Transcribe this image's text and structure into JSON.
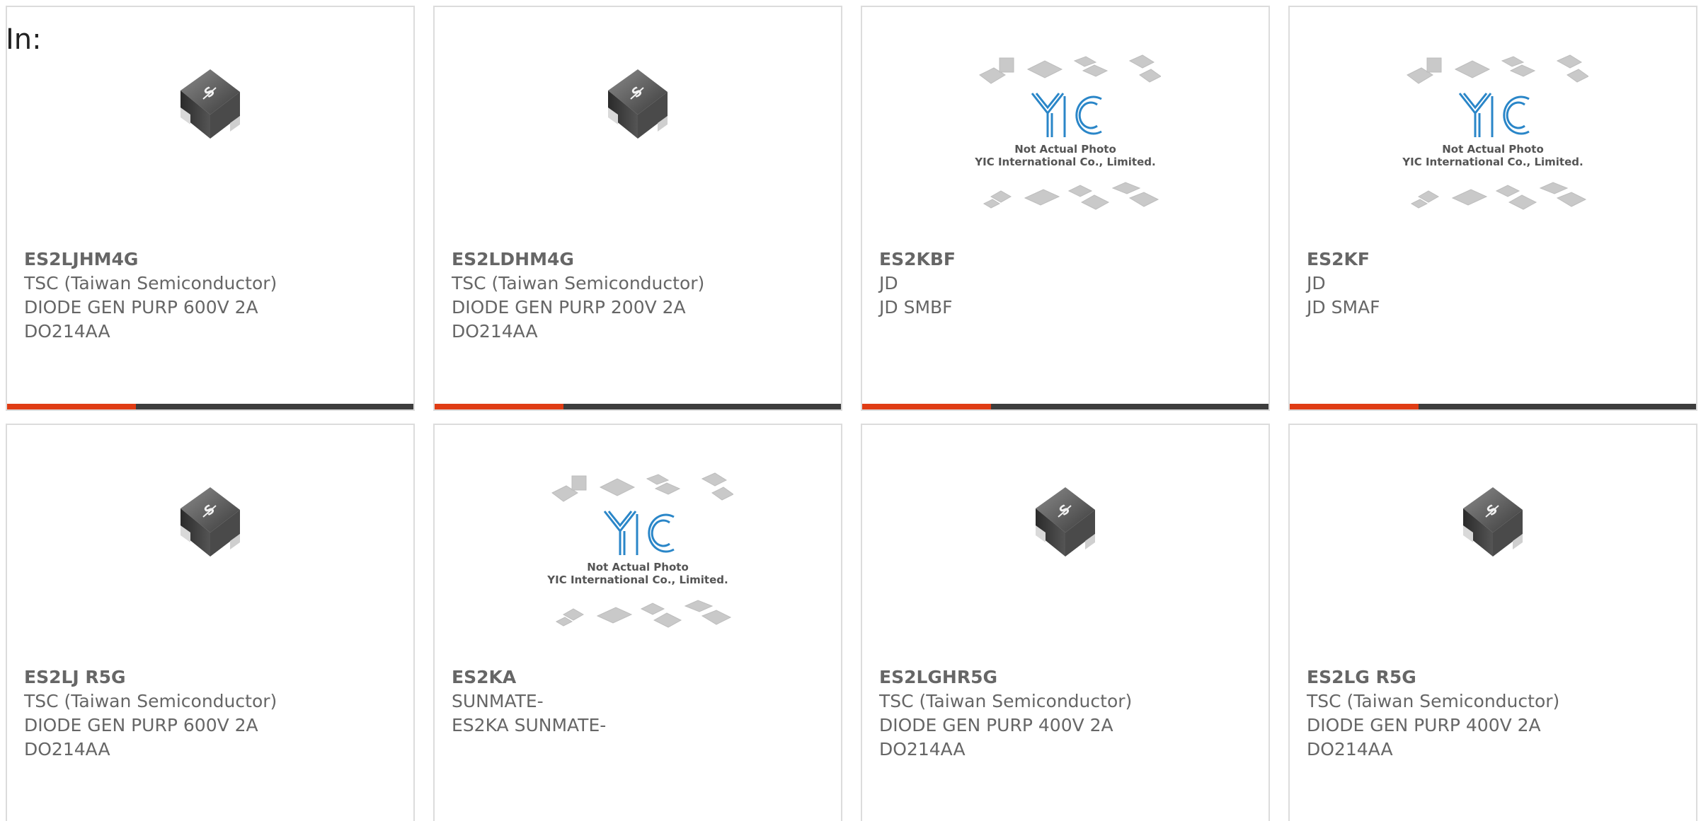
{
  "header": {
    "label": "In:"
  },
  "colors": {
    "accent_bar": "#e03c14",
    "bar": "#3d3d3d",
    "text": "#666666",
    "border": "#dcdcdc"
  },
  "products": [
    {
      "part_number": "ES2LJHM4G",
      "manufacturer": "TSC (Taiwan Semiconductor)",
      "description": "DIODE GEN PURP 600V 2A",
      "package": "DO214AA",
      "image": "smd-diode-chip-icon"
    },
    {
      "part_number": "ES2LDHM4G",
      "manufacturer": "TSC (Taiwan Semiconductor)",
      "description": "DIODE GEN PURP 200V 2A",
      "package": "DO214AA",
      "image": "smd-diode-chip-icon"
    },
    {
      "part_number": "ES2KBF",
      "manufacturer": "JD",
      "description": "JD SMBF",
      "package": "",
      "image": "yic-placeholder-image",
      "placeholder_line1": "Not Actual Photo",
      "placeholder_line2": "YIC International Co., Limited."
    },
    {
      "part_number": "ES2KF",
      "manufacturer": "JD",
      "description": "JD SMAF",
      "package": "",
      "image": "yic-placeholder-image",
      "placeholder_line1": "Not Actual Photo",
      "placeholder_line2": "YIC International Co., Limited."
    },
    {
      "part_number": "ES2LJ R5G",
      "manufacturer": "TSC (Taiwan Semiconductor)",
      "description": "DIODE GEN PURP 600V 2A",
      "package": "DO214AA",
      "image": "smd-diode-chip-icon"
    },
    {
      "part_number": "ES2KA",
      "manufacturer": "SUNMATE-",
      "description": "ES2KA SUNMATE-",
      "package": "",
      "image": "yic-placeholder-image",
      "placeholder_line1": "Not Actual Photo",
      "placeholder_line2": "YIC International Co., Limited."
    },
    {
      "part_number": "ES2LGHR5G",
      "manufacturer": "TSC (Taiwan Semiconductor)",
      "description": "DIODE GEN PURP 400V 2A",
      "package": "DO214AA",
      "image": "smd-diode-chip-icon"
    },
    {
      "part_number": "ES2LG R5G",
      "manufacturer": "TSC (Taiwan Semiconductor)",
      "description": "DIODE GEN PURP 400V 2A",
      "package": "DO214AA",
      "image": "smd-diode-chip-icon"
    }
  ]
}
